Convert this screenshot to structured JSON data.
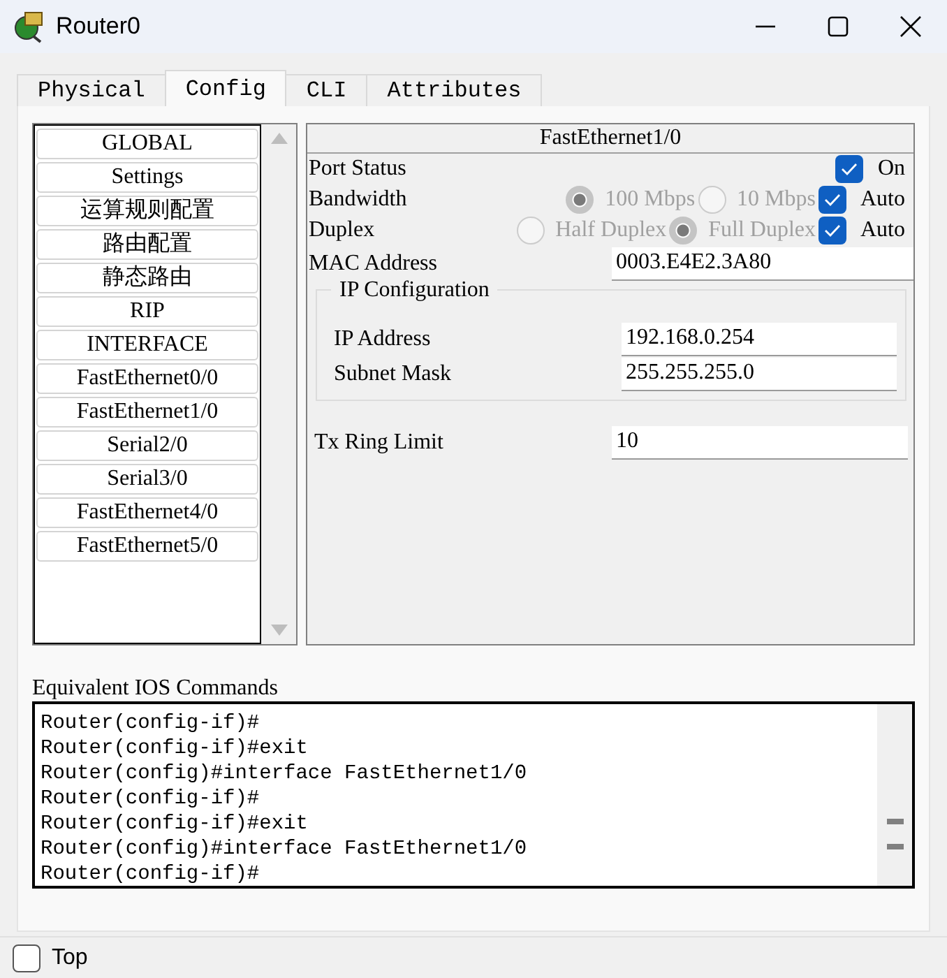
{
  "window": {
    "title": "Router0"
  },
  "tabs": [
    {
      "label": "Physical",
      "selected": false
    },
    {
      "label": "Config",
      "selected": true
    },
    {
      "label": "CLI",
      "selected": false
    },
    {
      "label": "Attributes",
      "selected": false
    }
  ],
  "sidebar": {
    "items": [
      {
        "label": "GLOBAL"
      },
      {
        "label": "Settings"
      },
      {
        "label": "运算规则配置"
      },
      {
        "label": "路由配置"
      },
      {
        "label": "静态路由"
      },
      {
        "label": "RIP"
      },
      {
        "label": "INTERFACE"
      },
      {
        "label": "FastEthernet0/0"
      },
      {
        "label": "FastEthernet1/0"
      },
      {
        "label": "Serial2/0"
      },
      {
        "label": "Serial3/0"
      },
      {
        "label": "FastEthernet4/0"
      },
      {
        "label": "FastEthernet5/0"
      }
    ]
  },
  "interface_panel": {
    "title": "FastEthernet1/0",
    "port_status": {
      "label": "Port Status",
      "checkbox": {
        "label": "On",
        "checked": true
      }
    },
    "settings": [
      {
        "label": "Bandwidth",
        "disabled": true,
        "options": [
          {
            "label": "100 Mbps",
            "selected": true
          },
          {
            "label": "10 Mbps",
            "selected": false
          }
        ],
        "auto": {
          "label": "Auto",
          "checked": true
        }
      },
      {
        "label": "Duplex",
        "disabled": true,
        "options": [
          {
            "label": "Half Duplex",
            "selected": false
          },
          {
            "label": "Full Duplex",
            "selected": true
          }
        ],
        "auto": {
          "label": "Auto",
          "checked": true
        }
      }
    ],
    "mac_address": {
      "label": "MAC Address",
      "value": "0003.E4E2.3A80"
    },
    "ip_configuration": {
      "title": "IP Configuration",
      "fields": [
        {
          "label": "IP Address",
          "value": "192.168.0.254"
        },
        {
          "label": "Subnet Mask",
          "value": "255.255.255.0"
        }
      ]
    },
    "tx_ring_limit": {
      "label": "Tx Ring Limit",
      "value": "10"
    }
  },
  "console": {
    "label": "Equivalent IOS Commands",
    "lines": [
      "Router(config-if)#",
      "Router(config-if)#exit",
      "Router(config)#interface FastEthernet1/0",
      "Router(config-if)#",
      "Router(config-if)#exit",
      "Router(config)#interface FastEthernet1/0",
      "Router(config-if)#"
    ]
  },
  "footer": {
    "top_checkbox": {
      "label": "Top",
      "checked": false
    }
  }
}
